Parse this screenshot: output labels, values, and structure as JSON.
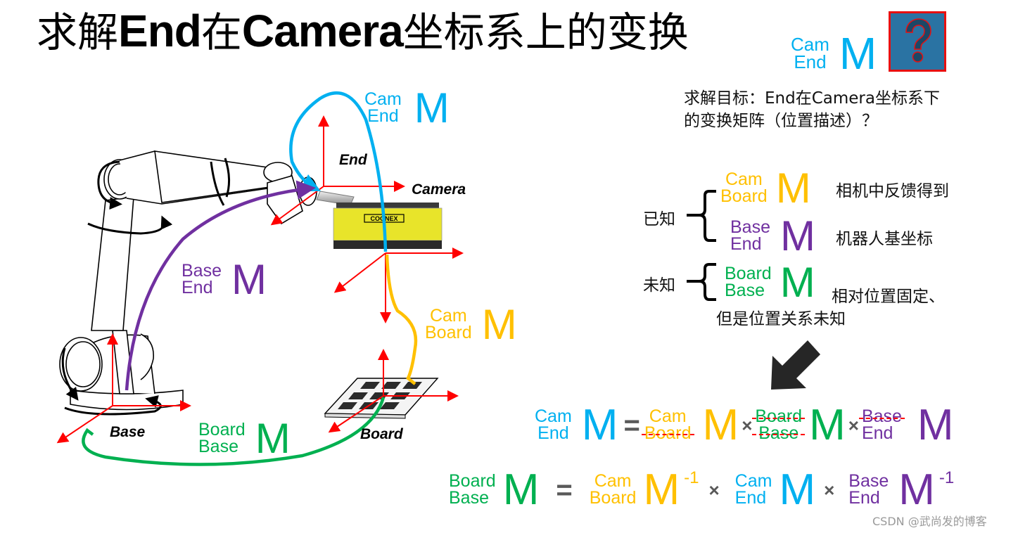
{
  "title": {
    "part1": "求解",
    "end": "End",
    "part2": "在",
    "camera": "Camera",
    "part3": "坐标系上的变换"
  },
  "colors": {
    "cam_end": "#00b0f0",
    "cam_board": "#ffc000",
    "base_end": "#7030a0",
    "board_base": "#00b050",
    "axis": "#ff0000",
    "question_box": "#2a73a3"
  },
  "target": {
    "matrix": {
      "top": "Cam",
      "bottom": "End",
      "symbol": "M"
    },
    "question_icon": "question-mark-icon",
    "question_glyph": "?"
  },
  "goal": {
    "line1": "求解目标：End在Camera坐标系下",
    "line2": "的变换矩阵（位置描述）？"
  },
  "known": {
    "label": "已知",
    "items": [
      {
        "top": "Cam",
        "bottom": "Board",
        "symbol": "M",
        "note": "相机中反馈得到"
      },
      {
        "top": "Base",
        "bottom": "End",
        "symbol": "M",
        "note": "机器人基坐标"
      }
    ]
  },
  "unknown": {
    "label": "未知",
    "items": [
      {
        "top": "Board",
        "bottom": "Base",
        "symbol": "M",
        "note_line1": "相对位置固定、",
        "note_line2": "但是位置关系未知"
      }
    ]
  },
  "diagram": {
    "frames": [
      "End",
      "Camera",
      "Base",
      "Board"
    ],
    "camera_brand": "COGNEX",
    "transforms": [
      {
        "top": "Cam",
        "bottom": "End",
        "symbol": "M"
      },
      {
        "top": "Base",
        "bottom": "End",
        "symbol": "M"
      },
      {
        "top": "Cam",
        "bottom": "Board",
        "symbol": "M"
      },
      {
        "top": "Board",
        "bottom": "Base",
        "symbol": "M"
      }
    ]
  },
  "equation1": {
    "lhs": {
      "top": "Cam",
      "bottom": "End",
      "symbol": "M"
    },
    "eq": "=",
    "terms": [
      {
        "top": "Cam",
        "bottom": "Board",
        "symbol": "M",
        "struck": "bottom"
      },
      {
        "top": "Board",
        "bottom": "Base",
        "symbol": "M",
        "struck": "both"
      },
      {
        "top": "Base",
        "bottom": "End",
        "symbol": "M",
        "struck": "top"
      }
    ],
    "times": "×"
  },
  "equation2": {
    "lhs": {
      "top": "Board",
      "bottom": "Base",
      "symbol": "M"
    },
    "eq": "=",
    "terms": [
      {
        "top": "Cam",
        "bottom": "Board",
        "symbol": "M",
        "exp": "-1"
      },
      {
        "top": "Cam",
        "bottom": "End",
        "symbol": "M",
        "exp": ""
      },
      {
        "top": "Base",
        "bottom": "End",
        "symbol": "M",
        "exp": "-1"
      }
    ],
    "times": "×"
  },
  "watermark": "CSDN @武尚发的博客"
}
